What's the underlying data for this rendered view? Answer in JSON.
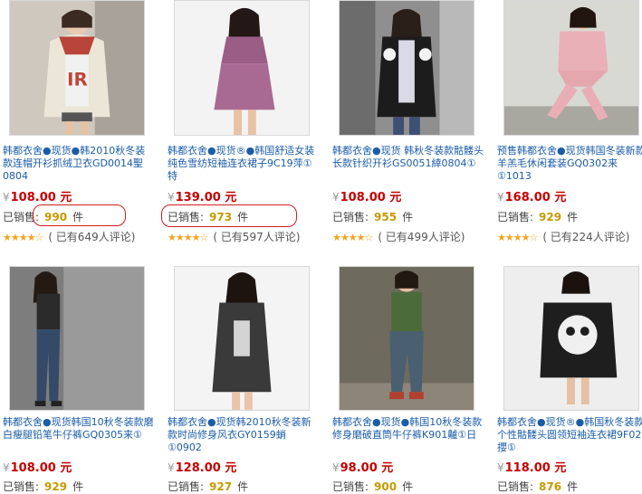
{
  "labels": {
    "sold_prefix": "已销售:",
    "sold_unit": "件",
    "currency": "¥"
  },
  "colors": {
    "title_link": "#1a5ca8",
    "price": "#c50000",
    "sold_count": "#c49a00",
    "stars": "#f4a31d",
    "highlight_oval": "#d21f1f"
  },
  "products": [
    {
      "title": "韩都衣舍●现货●韩2010秋冬装款连帽开衫抓绒卫衣GD0014聖0804",
      "price": "108.00 元",
      "sold": "990",
      "stars": "★★★★☆",
      "reviews": "( 已有649人评论)"
    },
    {
      "title": "韩都衣舍●现货®●韩国舒适女装纯色雪纺短袖连衣裙子9C19萍①特",
      "price": "139.00 元",
      "sold": "973",
      "stars": "★★★★☆",
      "reviews": "( 已有597人评论)"
    },
    {
      "title": "韩都衣舍●现货  韩秋冬装款骷髅头长款针织开衫GS0051緈0804①",
      "price": "108.00 元",
      "sold": "955",
      "stars": "★★★★☆",
      "reviews": "( 已有499人评论)"
    },
    {
      "title": "预售韩都衣舍●现货韩国冬装新款羊羔毛休闲套装GQ0302来①1013",
      "price": "168.00 元",
      "sold": "929",
      "stars": "★★★★☆",
      "reviews": "( 已有224人评论)"
    },
    {
      "title": "韩都衣舍●现货韩国10秋冬装款磨白瘦腿铅笔牛仔裤GQ0305来①",
      "price": "108.00 元",
      "sold": "929",
      "stars": "",
      "reviews": ""
    },
    {
      "title": "韩都衣舍●现货韩2010秋冬装新款时尚修身风衣GY0159蛸①0902",
      "price": "128.00 元",
      "sold": "927",
      "stars": "",
      "reviews": ""
    },
    {
      "title": "韩都衣舍●现货●韩国10秋冬装款修身磨破直筒牛仔裤K901齇①日",
      "price": "98.00 元",
      "sold": "900",
      "stars": "",
      "reviews": ""
    },
    {
      "title": "韩都衣舍●现货®●韩国秋冬装款个性骷髅头圆领短袖连衣裙9F02攖①",
      "price": "118.00 元",
      "sold": "876",
      "stars": "",
      "reviews": ""
    }
  ]
}
